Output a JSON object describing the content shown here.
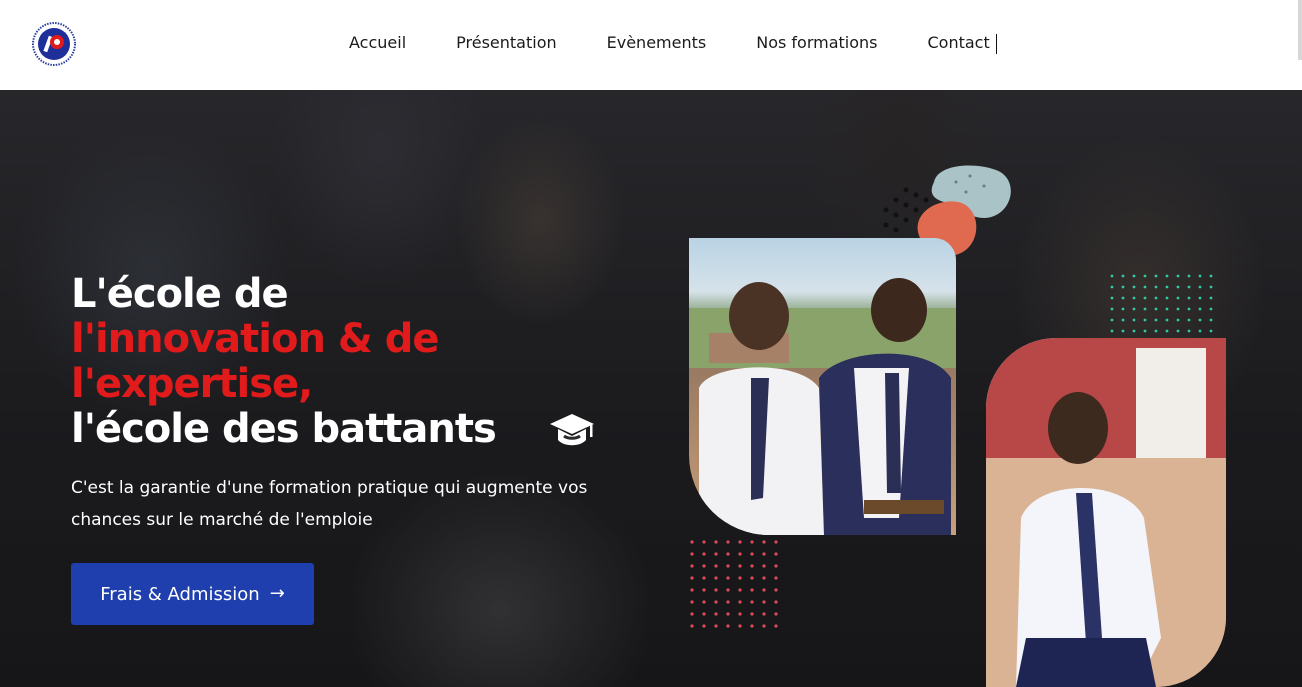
{
  "nav": {
    "items": [
      "Accueil",
      "Présentation",
      "Evènements",
      "Nos formations",
      "Contact"
    ]
  },
  "hero": {
    "headline_line1": "L'école de",
    "headline_red1": "l'innovation & de",
    "headline_red2": "l'expertise,",
    "headline_line4": "l'école des battants",
    "subtitle": "C'est la garantie d'une formation pratique qui augmente vos chances sur le marché de l'emploie",
    "cta_label": "Frais & Admission",
    "cta_arrow": "→"
  },
  "colors": {
    "accent_red": "#e11b1b",
    "cta_blue": "#1f3fae",
    "blob_grey": "#a9c3c6",
    "blob_orange": "#e06a50",
    "dots_teal": "#33c7a6",
    "dots_red": "#e04a5a"
  },
  "icons": {
    "logo": "school-logo",
    "cap": "graduation-cap-icon",
    "arrow": "arrow-right-icon"
  }
}
